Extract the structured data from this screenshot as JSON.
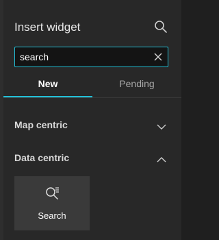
{
  "header": {
    "title": "Insert widget",
    "search_icon": "search-icon"
  },
  "search": {
    "value": "search",
    "clear_icon": "close-icon"
  },
  "tabs": [
    {
      "label": "New",
      "active": true
    },
    {
      "label": "Pending",
      "active": false
    }
  ],
  "sections": [
    {
      "label": "Map centric",
      "expanded": false,
      "icon": "chevron-down-icon"
    },
    {
      "label": "Data centric",
      "expanded": true,
      "icon": "chevron-up-icon"
    }
  ],
  "widgets": [
    {
      "label": "Search",
      "icon": "search-widget-icon"
    }
  ],
  "colors": {
    "accent": "#22c0d8",
    "panel_bg": "#282828",
    "card_bg": "#3a3a3a"
  }
}
